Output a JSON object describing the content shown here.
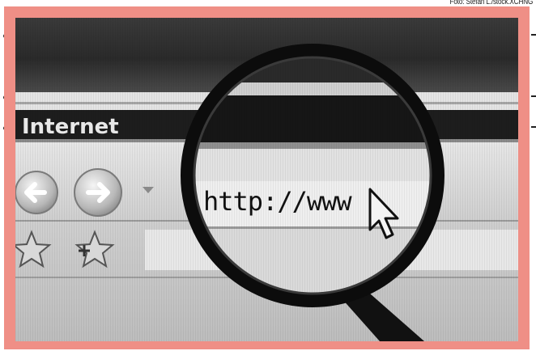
{
  "photo_credit": "Foto: Stefan L./stock.XCHNG",
  "photo": {
    "browser_label": "Internet",
    "url_text": "http://www",
    "icons": [
      "back-arrow-icon",
      "forward-arrow-icon",
      "dropdown-arrow-icon",
      "favorites-star-icon",
      "add-favorite-star-icon",
      "mouse-cursor-icon",
      "magnifying-glass-icon"
    ],
    "frame_color": "#ef8f86"
  }
}
